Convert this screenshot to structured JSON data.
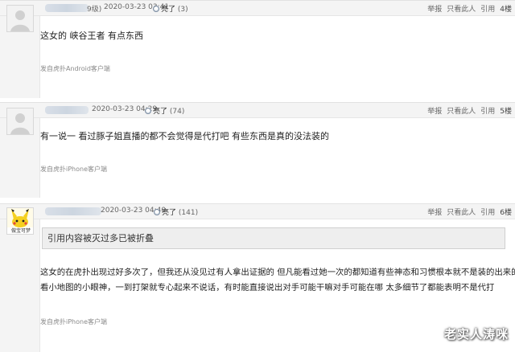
{
  "posts": [
    {
      "level": "9级)",
      "time": "2020-03-23 03:41",
      "light_label": "亮了",
      "light_count": "(3)",
      "actions": [
        "举报",
        "只看此人",
        "引用"
      ],
      "floor": "4楼",
      "content": "这女的 峡谷王者 有点东西",
      "source": "发自虎扑Android客户端"
    },
    {
      "time": "2020-03-23 04:29",
      "light_label": "亮了",
      "light_count": "(74)",
      "actions": [
        "举报",
        "只看此人",
        "引用"
      ],
      "floor": "5楼",
      "content": "有一说一 看过豚子姐直播的都不会觉得是代打吧 有些东西是真的没法装的",
      "source": "发自虎扑iPhone客户端"
    },
    {
      "time": "2020-03-23 04:40",
      "light_label": "亮了",
      "light_count": "(141)",
      "actions": [
        "举报",
        "只看此人",
        "引用"
      ],
      "floor": "6楼",
      "avatar_caption": "做宝可梦",
      "quote": "引用内容被灭过多已被折叠",
      "content_line1": "这女的在虎扑出现过好多次了，但我还从没见过有人拿出证据的 但凡能看过她一次的都知道有些神态和习惯根本就不是装的出来的",
      "content_line2": "看小地图的小眼神，一到打架就专心起来不说话，有时能直接说出对手可能干嘛对手可能在哪 太多细节了都能表明不是代打",
      "source": "发自虎扑iPhone客户端"
    }
  ],
  "watermark": "老实人涛咪"
}
